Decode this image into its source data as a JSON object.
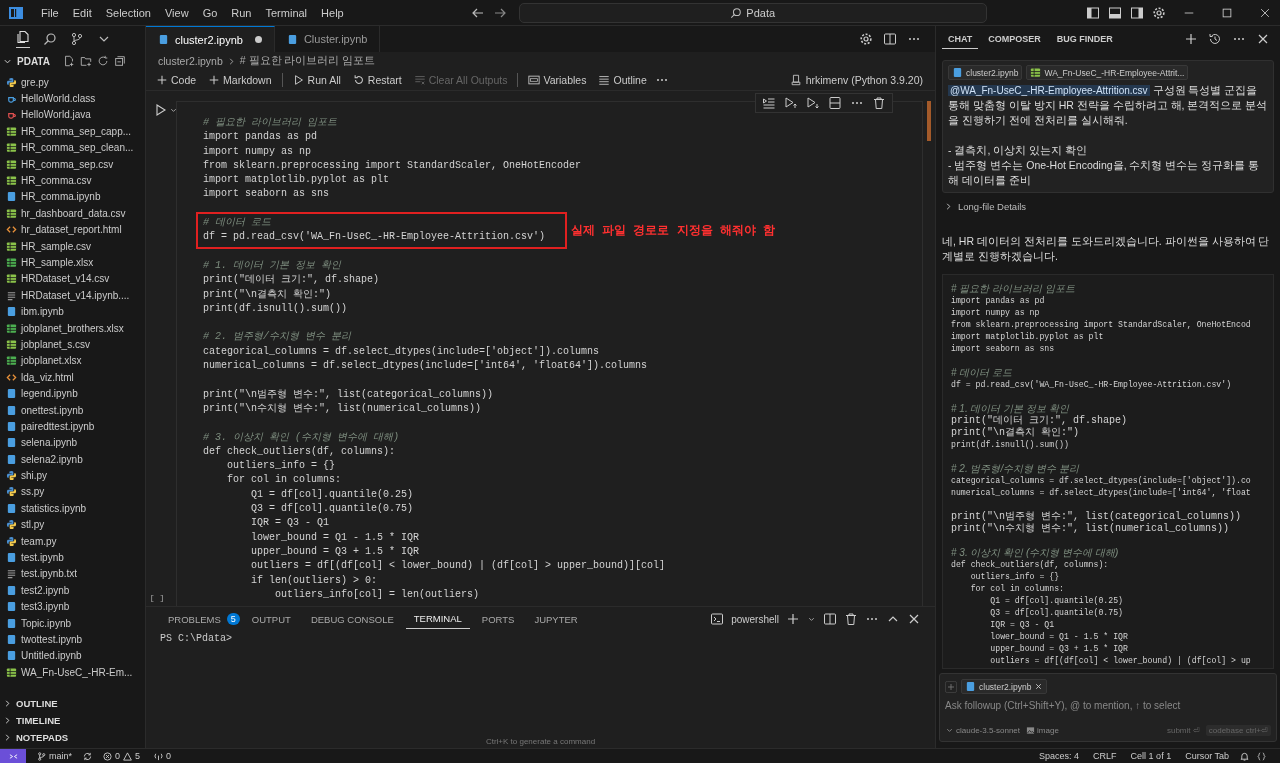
{
  "title_bar": {
    "menus": [
      "File",
      "Edit",
      "Selection",
      "View",
      "Go",
      "Run",
      "Terminal",
      "Help"
    ],
    "search": "Pdata"
  },
  "sidebar": {
    "folder": "PDATA",
    "expanded": true,
    "files": [
      {
        "name": "gre.py",
        "kind": "python"
      },
      {
        "name": "HelloWorld.class",
        "kind": "class"
      },
      {
        "name": "HelloWorld.java",
        "kind": "java"
      },
      {
        "name": "HR_comma_sep_capp...",
        "kind": "table"
      },
      {
        "name": "HR_comma_sep_clean...",
        "kind": "table"
      },
      {
        "name": "HR_comma_sep.csv",
        "kind": "table"
      },
      {
        "name": "HR_comma.csv",
        "kind": "table"
      },
      {
        "name": "HR_comma.ipynb",
        "kind": "notebook"
      },
      {
        "name": "hr_dashboard_data.csv",
        "kind": "table"
      },
      {
        "name": "hr_dataset_report.html",
        "kind": "html"
      },
      {
        "name": "HR_sample.csv",
        "kind": "table"
      },
      {
        "name": "HR_sample.xlsx",
        "kind": "excel"
      },
      {
        "name": "HRDataset_v14.csv",
        "kind": "table"
      },
      {
        "name": "HRDataset_v14.ipynb....",
        "kind": "text"
      },
      {
        "name": "ibm.ipynb",
        "kind": "notebook"
      },
      {
        "name": "jobplanet_brothers.xlsx",
        "kind": "excel"
      },
      {
        "name": "jobplanet_s.csv",
        "kind": "table"
      },
      {
        "name": "jobplanet.xlsx",
        "kind": "excel"
      },
      {
        "name": "lda_viz.html",
        "kind": "html"
      },
      {
        "name": "legend.ipynb",
        "kind": "notebook"
      },
      {
        "name": "onettest.ipynb",
        "kind": "notebook"
      },
      {
        "name": "pairedttest.ipynb",
        "kind": "notebook"
      },
      {
        "name": "selena.ipynb",
        "kind": "notebook"
      },
      {
        "name": "selena2.ipynb",
        "kind": "notebook"
      },
      {
        "name": "shi.py",
        "kind": "python"
      },
      {
        "name": "ss.py",
        "kind": "python"
      },
      {
        "name": "statistics.ipynb",
        "kind": "notebook"
      },
      {
        "name": "stl.py",
        "kind": "python"
      },
      {
        "name": "team.py",
        "kind": "python"
      },
      {
        "name": "test.ipynb",
        "kind": "notebook"
      },
      {
        "name": "test.ipynb.txt",
        "kind": "text"
      },
      {
        "name": "test2.ipynb",
        "kind": "notebook"
      },
      {
        "name": "test3.ipynb",
        "kind": "notebook"
      },
      {
        "name": "Topic.ipynb",
        "kind": "notebook"
      },
      {
        "name": "twottest.ipynb",
        "kind": "notebook"
      },
      {
        "name": "Untitled.ipynb",
        "kind": "notebook"
      },
      {
        "name": "WA_Fn-UseC_-HR-Em...",
        "kind": "table"
      }
    ],
    "sections": [
      {
        "label": "OUTLINE",
        "expanded": false
      },
      {
        "label": "TIMELINE",
        "expanded": false
      },
      {
        "label": "NOTEPADS",
        "expanded": false
      }
    ]
  },
  "editor": {
    "tabs": [
      {
        "label": "cluster2.ipynb",
        "selected": true,
        "dirty": true
      },
      {
        "label": "Cluster.ipynb",
        "selected": false,
        "dirty": false
      }
    ],
    "breadcrumb": [
      "cluster2.ipynb",
      "# 필요한 라이브러리 임포트"
    ],
    "toolbar": [
      {
        "label": "Code",
        "kind": "plus"
      },
      {
        "label": "Markdown",
        "kind": "plus"
      },
      {
        "kind": "separator"
      },
      {
        "label": "Run All",
        "kind": "run"
      },
      {
        "label": "Restart",
        "kind": "restart"
      },
      {
        "label": "Clear All Outputs",
        "kind": "clear",
        "disabled": true
      },
      {
        "kind": "separator"
      },
      {
        "label": "Variables",
        "kind": "variables"
      },
      {
        "label": "Outline",
        "kind": "outline"
      },
      {
        "kind": "more"
      }
    ],
    "kernel": "hrkimenv (Python 3.9.20)",
    "cell": {
      "execution": "[ ]",
      "lines_before": [
        {
          "kind": "comment",
          "text": "# 필요한 라이브러리 임포트"
        },
        {
          "kind": "code",
          "text": "import pandas as pd"
        },
        {
          "kind": "code",
          "text": "import numpy as np"
        },
        {
          "kind": "code",
          "text": "from sklearn.preprocessing import StandardScaler, OneHotEncoder"
        },
        {
          "kind": "code",
          "text": "import matplotlib.pyplot as plt"
        },
        {
          "kind": "code",
          "text": "import seaborn as sns"
        },
        {
          "kind": "blank"
        }
      ],
      "annotated": {
        "lines": [
          {
            "kind": "comment",
            "text": "# 데이터 로드"
          },
          {
            "kind": "code",
            "text": "df = pd.read_csv('WA_Fn-UseC_-HR-Employee-Attrition.csv')"
          }
        ],
        "note": "실제 파일 경로로 지정을 해줘야 함"
      },
      "lines_after": [
        {
          "kind": "blank"
        },
        {
          "kind": "comment",
          "text": "# 1. 데이터 기본 정보 확인"
        },
        {
          "kind": "code",
          "text": "print(\"데이터 크기:\", df.shape)"
        },
        {
          "kind": "code",
          "text": "print(\"\\n결측치 확인:\")"
        },
        {
          "kind": "code",
          "text": "print(df.isnull().sum())"
        },
        {
          "kind": "blank"
        },
        {
          "kind": "comment",
          "text": "# 2. 범주형/수치형 변수 분리"
        },
        {
          "kind": "code",
          "text": "categorical_columns = df.select_dtypes(include=['object']).columns"
        },
        {
          "kind": "code",
          "text": "numerical_columns = df.select_dtypes(include=['int64', 'float64']).columns"
        },
        {
          "kind": "blank"
        },
        {
          "kind": "code",
          "text": "print(\"\\n범주형 변수:\", list(categorical_columns))"
        },
        {
          "kind": "code",
          "text": "print(\"\\n수치형 변수:\", list(numerical_columns))"
        },
        {
          "kind": "blank"
        },
        {
          "kind": "comment",
          "text": "# 3. 이상치 확인 (수치형 변수에 대해)"
        },
        {
          "kind": "code",
          "text": "def check_outliers(df, columns):"
        },
        {
          "kind": "code",
          "text": "    outliers_info = {}"
        },
        {
          "kind": "code",
          "text": "    for col in columns:"
        },
        {
          "kind": "code",
          "text": "        Q1 = df[col].quantile(0.25)"
        },
        {
          "kind": "code",
          "text": "        Q3 = df[col].quantile(0.75)"
        },
        {
          "kind": "code",
          "text": "        IQR = Q3 - Q1"
        },
        {
          "kind": "code",
          "text": "        lower_bound = Q1 - 1.5 * IQR"
        },
        {
          "kind": "code",
          "text": "        upper_bound = Q3 + 1.5 * IQR"
        },
        {
          "kind": "code",
          "text": "        outliers = df[(df[col] < lower_bound) | (df[col] > upper_bound)][col]"
        },
        {
          "kind": "code",
          "text": "        if len(outliers) > 0:"
        },
        {
          "kind": "code",
          "text": "            outliers_info[col] = len(outliers)"
        }
      ]
    }
  },
  "panel": {
    "tabs": [
      {
        "label": "PROBLEMS",
        "selected": false,
        "badge": "5"
      },
      {
        "label": "OUTPUT",
        "selected": false
      },
      {
        "label": "DEBUG CONSOLE",
        "selected": false
      },
      {
        "label": "TERMINAL",
        "selected": true
      },
      {
        "label": "PORTS",
        "selected": false
      },
      {
        "label": "JUPYTER",
        "selected": false
      }
    ],
    "shell": "powershell",
    "prompt": "PS C:\\Pdata>",
    "hint": "Ctrl+K to generate a command"
  },
  "chat": {
    "tabs": [
      {
        "label": "CHAT",
        "selected": true
      },
      {
        "label": "COMPOSER",
        "selected": false
      },
      {
        "label": "BUG FINDER",
        "selected": false
      }
    ],
    "message": {
      "attachments": [
        {
          "name": "cluster2.ipynb",
          "kind": "notebook"
        },
        {
          "name": "WA_Fn-UseC_-HR-Employee-Attrit...",
          "kind": "table"
        }
      ],
      "mention": "@WA_Fn-UseC_-HR-Employee-Attrition.csv",
      "text": "구성원 특성별 군집을 통해 맞춤형 이탈 방지 HR 전략을 수립하려고 해, 본격적으로 분석을 진행하기 전에 전처리를 실시해줘.",
      "bullets": [
        "- 결측치, 이상치 있는지 확인",
        "- 범주형 변수는 One-Hot Encoding을, 수치형 변수는 정규화를 통해 데이터를 준비"
      ]
    },
    "details": {
      "label": "Long-file Details",
      "expanded": false
    },
    "reply": "네, HR 데이터의 전처리를 도와드리겠습니다. 파이썬을 사용하여 단계별로 진행하겠습니다.",
    "code": [
      {
        "kind": "comment",
        "text": "# 필요한 라이브러리 임포트"
      },
      {
        "kind": "code",
        "text": "import pandas as pd"
      },
      {
        "kind": "code",
        "text": "import numpy as np"
      },
      {
        "kind": "code",
        "text": "from sklearn.preprocessing import StandardScaler, OneHotEncod"
      },
      {
        "kind": "code",
        "text": "import matplotlib.pyplot as plt"
      },
      {
        "kind": "code",
        "text": "import seaborn as sns"
      },
      {
        "kind": "blank"
      },
      {
        "kind": "comment",
        "text": "# 데이터 로드"
      },
      {
        "kind": "code",
        "text": "df = pd.read_csv('WA_Fn-UseC_-HR-Employee-Attrition.csv')"
      },
      {
        "kind": "blank"
      },
      {
        "kind": "comment",
        "text": "# 1. 데이터 기본 정보 확인"
      },
      {
        "kind": "code",
        "text": "print(\"데이터 크기:\", df.shape)"
      },
      {
        "kind": "code",
        "text": "print(\"\\n결측치 확인:\")"
      },
      {
        "kind": "code",
        "text": "print(df.isnull().sum())"
      },
      {
        "kind": "blank"
      },
      {
        "kind": "comment",
        "text": "# 2. 범주형/수치형 변수 분리"
      },
      {
        "kind": "code",
        "text": "categorical_columns = df.select_dtypes(include=['object']).co"
      },
      {
        "kind": "code",
        "text": "numerical_columns = df.select_dtypes(include=['int64', 'float"
      },
      {
        "kind": "blank"
      },
      {
        "kind": "code",
        "text": "print(\"\\n범주형 변수:\", list(categorical_columns))"
      },
      {
        "kind": "code",
        "text": "print(\"\\n수치형 변수:\", list(numerical_columns))"
      },
      {
        "kind": "blank"
      },
      {
        "kind": "comment",
        "text": "# 3. 이상치 확인 (수치형 변수에 대해)"
      },
      {
        "kind": "code",
        "text": "def check_outliers(df, columns):"
      },
      {
        "kind": "code",
        "text": "    outliers_info = {}"
      },
      {
        "kind": "code",
        "text": "    for col in columns:"
      },
      {
        "kind": "code",
        "text": "        Q1 = df[col].quantile(0.25)"
      },
      {
        "kind": "code",
        "text": "        Q3 = df[col].quantile(0.75)"
      },
      {
        "kind": "code",
        "text": "        IQR = Q3 - Q1"
      },
      {
        "kind": "code",
        "text": "        lower_bound = Q1 - 1.5 * IQR"
      },
      {
        "kind": "code",
        "text": "        upper_bound = Q3 + 1.5 * IQR"
      },
      {
        "kind": "code",
        "text": "        outliers = df[(df[col] < lower_bound) | (df[col] > up"
      }
    ],
    "input": {
      "context": "cluster2.ipynb",
      "placeholder": "Ask followup (Ctrl+Shift+Y), @ to mention, ↑ to select",
      "model": "claude-3.5-sonnet",
      "image": "image",
      "submit": "submit ⏎",
      "codebase": "codebase ctrl+⏎"
    }
  },
  "status_bar": {
    "branch": "main*",
    "errors": "0",
    "warnings": "5",
    "ports": "0",
    "right": [
      "Spaces: 4",
      "CRLF",
      "Cell 1 of 1",
      "Cursor Tab"
    ]
  }
}
